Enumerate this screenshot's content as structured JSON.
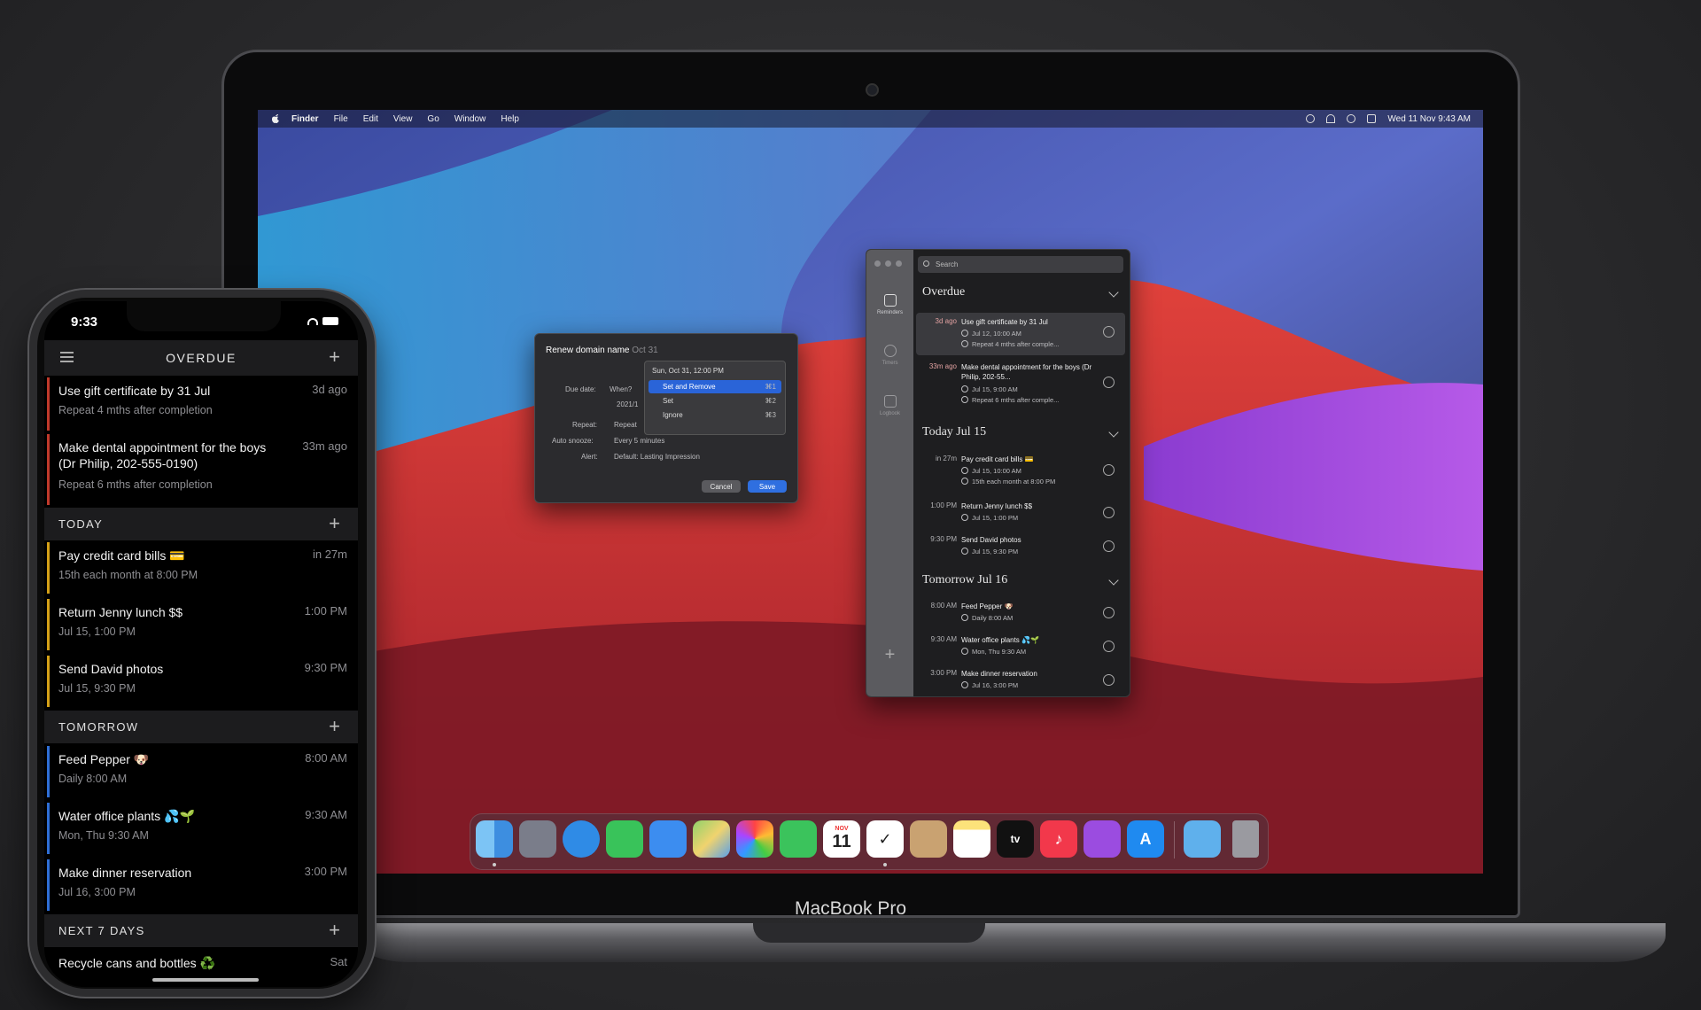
{
  "mac": {
    "caption": "MacBook Pro",
    "menubar": {
      "items": [
        "Finder",
        "File",
        "Edit",
        "View",
        "Go",
        "Window",
        "Help"
      ],
      "clock": "Wed 11 Nov 9:43 AM"
    },
    "dock_icons": [
      "finder-icon",
      "launchpad-icon",
      "safari-icon",
      "messages-icon",
      "mail-icon",
      "maps-icon",
      "photos-icon",
      "facetime-icon",
      "calendar-icon",
      "reminders-app-icon",
      "contacts-icon",
      "notes-icon",
      "apple-tv-icon",
      "music-icon",
      "podcasts-icon",
      "app-store-icon",
      "downloads-folder-icon",
      "trash-icon"
    ],
    "calendar_day": "11",
    "calendar_month": "NOV",
    "tv_label": "tv"
  },
  "dialog": {
    "title": "Renew domain name",
    "title_placeholder": "Oct 31",
    "due_date_label": "Due date:",
    "when_label": "When?",
    "date_suggestion": "Sun, Oct 31, 12:00 PM",
    "year_value": "2021/1",
    "options": [
      {
        "label": "Set and Remove",
        "shortcut": "⌘1"
      },
      {
        "label": "Set",
        "shortcut": "⌘2"
      },
      {
        "label": "Ignore",
        "shortcut": "⌘3"
      }
    ],
    "repeat_label": "Repeat:",
    "repeat_value": "Repeat",
    "autosnooze_label": "Auto snooze:",
    "autosnooze_value": "Every 5 minutes",
    "alert_label": "Alert:",
    "alert_value": "Default: Lasting Impression",
    "cancel": "Cancel",
    "save": "Save"
  },
  "app": {
    "sidebar": [
      {
        "label": "Reminders"
      },
      {
        "label": "Timers"
      },
      {
        "label": "Logbook"
      }
    ],
    "search_placeholder": "Search",
    "sections": [
      {
        "title": "Overdue",
        "items": [
          {
            "when": "3d ago",
            "text": "Use gift certificate by 31 Jul",
            "sub1": "Jul 12, 10:00 AM",
            "sub2": "Repeat 4 mths after comple..."
          },
          {
            "when": "33m ago",
            "text": "Make dental appointment for the boys (Dr Philip, 202-55...",
            "sub1": "Jul 15, 9:00 AM",
            "sub2": "Repeat 6 mths after comple..."
          }
        ]
      },
      {
        "title": "Today Jul 15",
        "items": [
          {
            "when": "in 27m",
            "text": "Pay credit card bills 💳",
            "sub1": "Jul 15, 10:00 AM",
            "sub2": "15th each month at 8:00 PM"
          },
          {
            "when": "1:00 PM",
            "text": "Return Jenny lunch $$",
            "sub1": "Jul 15, 1:00 PM"
          },
          {
            "when": "9:30 PM",
            "text": "Send David photos",
            "sub1": "Jul 15, 9:30 PM"
          }
        ]
      },
      {
        "title": "Tomorrow Jul 16",
        "items": [
          {
            "when": "8:00 AM",
            "text": "Feed Pepper 🐶",
            "sub1": "Daily 8:00 AM"
          },
          {
            "when": "9:30 AM",
            "text": "Water office plants 💦🌱",
            "sub1": "Mon, Thu 9:30 AM"
          },
          {
            "when": "3:00 PM",
            "text": "Make dinner reservation",
            "sub1": "Jul 16, 3:00 PM"
          }
        ]
      }
    ]
  },
  "phone": {
    "time": "9:33",
    "nav_title": "OVERDUE",
    "overdue": [
      {
        "text": "Use gift certificate by 31 Jul",
        "sub": "Repeat 4 mths after completion",
        "when": "3d ago"
      },
      {
        "text": "Make dental appointment for the boys (Dr Philip, 202-555-0190)",
        "sub": "Repeat 6 mths after completion",
        "when": "33m ago"
      }
    ],
    "sections": [
      {
        "label": "TODAY",
        "items": [
          {
            "text": "Pay credit card bills 💳",
            "sub": "15th each month at 8:00 PM",
            "when": "in 27m"
          },
          {
            "text": "Return Jenny lunch $$",
            "sub": "Jul 15, 1:00 PM",
            "when": "1:00 PM"
          },
          {
            "text": "Send David photos",
            "sub": "Jul 15, 9:30 PM",
            "when": "9:30 PM"
          }
        ]
      },
      {
        "label": "TOMORROW",
        "items": [
          {
            "text": "Feed Pepper 🐶",
            "sub": "Daily 8:00 AM",
            "when": "8:00 AM"
          },
          {
            "text": "Water office plants 💦🌱",
            "sub": "Mon, Thu 9:30 AM",
            "when": "9:30 AM"
          },
          {
            "text": "Make dinner reservation",
            "sub": "Jul 16, 3:00 PM",
            "when": "3:00 PM"
          }
        ]
      },
      {
        "label": "NEXT 7 DAYS",
        "items": [
          {
            "text": "Recycle cans and bottles ♻️",
            "when": "Sat"
          }
        ]
      }
    ],
    "colors": {
      "overdue_bar": "#c0392b",
      "today_bar": "#d4a017",
      "tomorrow_bar": "#2f6fd6"
    }
  }
}
